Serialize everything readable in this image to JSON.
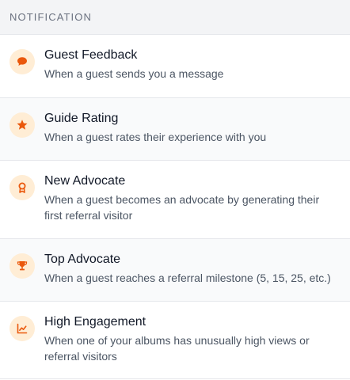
{
  "header": {
    "label": "NOTIFICATION"
  },
  "accent_color": "#ea580c",
  "icon_bg_color": "#ffedd5",
  "notifications": [
    {
      "icon": "chat-bubble-icon",
      "title": "Guest Feedback",
      "description": "When a guest sends you a message"
    },
    {
      "icon": "star-icon",
      "title": "Guide Rating",
      "description": "When a guest rates their experience with you"
    },
    {
      "icon": "award-icon",
      "title": "New Advocate",
      "description": "When a guest becomes an advocate by generating their first referral visitor"
    },
    {
      "icon": "trophy-icon",
      "title": "Top Advocate",
      "description": "When a guest reaches a referral milestone (5, 15, 25, etc.)"
    },
    {
      "icon": "chart-icon",
      "title": "High Engagement",
      "description": "When one of your albums has unusually high views or referral visitors"
    }
  ]
}
